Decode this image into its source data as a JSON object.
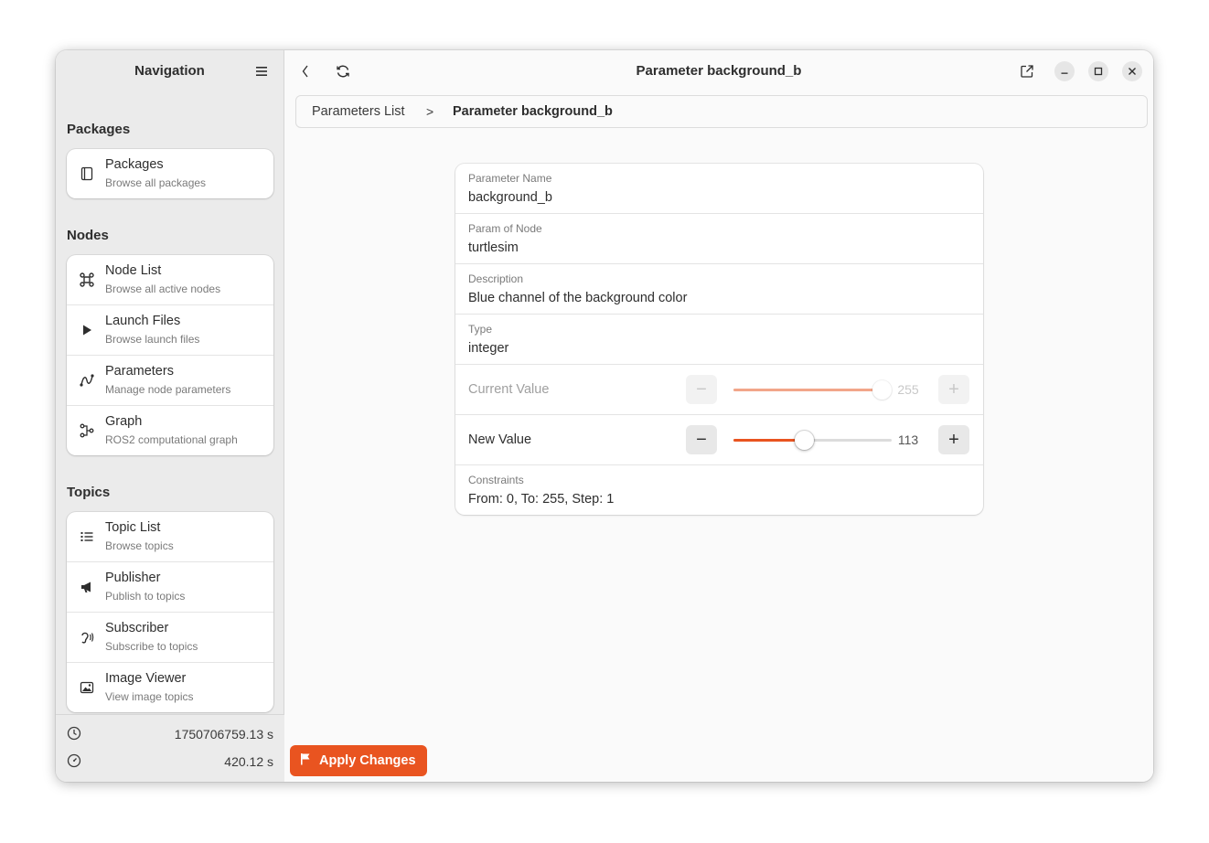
{
  "sidebar": {
    "title": "Navigation",
    "sections": [
      {
        "title": "Packages",
        "items": [
          {
            "label": "Packages",
            "subtitle": "Browse all packages",
            "icon": "book-icon"
          }
        ]
      },
      {
        "title": "Nodes",
        "items": [
          {
            "label": "Node List",
            "subtitle": "Browse all active nodes",
            "icon": "nodes-icon"
          },
          {
            "label": "Launch Files",
            "subtitle": "Browse launch files",
            "icon": "play-icon"
          },
          {
            "label": "Parameters",
            "subtitle": "Manage node parameters",
            "icon": "curve-icon"
          },
          {
            "label": "Graph",
            "subtitle": "ROS2 computational graph",
            "icon": "graph-icon"
          }
        ]
      },
      {
        "title": "Topics",
        "items": [
          {
            "label": "Topic List",
            "subtitle": "Browse topics",
            "icon": "list-icon"
          },
          {
            "label": "Publisher",
            "subtitle": "Publish to topics",
            "icon": "megaphone-icon"
          },
          {
            "label": "Subscriber",
            "subtitle": "Subscribe to topics",
            "icon": "ear-icon"
          },
          {
            "label": "Image Viewer",
            "subtitle": "View image topics",
            "icon": "image-icon"
          }
        ]
      }
    ],
    "footer": {
      "clock_value": "1750706759.13 s",
      "uptime_value": "420.12 s"
    }
  },
  "header": {
    "title": "Parameter background_b"
  },
  "breadcrumb": {
    "items": [
      "Parameters List",
      "Parameter background_b"
    ],
    "separator": ">"
  },
  "parameter": {
    "name_label": "Parameter Name",
    "name_value": "background_b",
    "node_label": "Param of Node",
    "node_value": "turtlesim",
    "description_label": "Description",
    "description_value": "Blue channel of the background color",
    "type_label": "Type",
    "type_value": "integer",
    "current_label": "Current Value",
    "current_value": "255",
    "new_label": "New Value",
    "new_value": "113",
    "range_min": 0,
    "range_max": 255,
    "constraints_label": "Constraints",
    "constraints_value": "From: 0, To: 255, Step: 1"
  },
  "actions": {
    "apply_label": "Apply Changes"
  },
  "colors": {
    "accent": "#e95420",
    "accent_disabled": "#f2a68a"
  }
}
